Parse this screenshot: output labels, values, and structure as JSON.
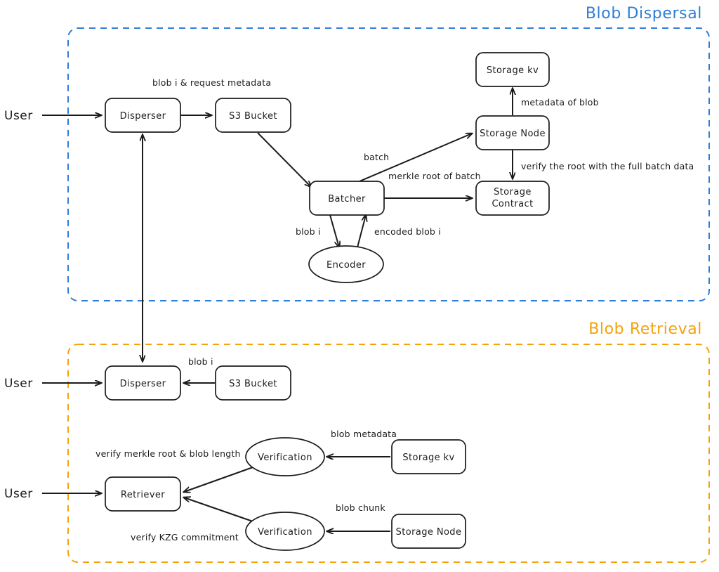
{
  "diagram": {
    "title_hidden": "",
    "colors": {
      "dispersal_accent": "#2f7ed8",
      "retrieval_accent": "#f5a30a",
      "stroke": "#1b1b1b",
      "background": "#ffffff"
    }
  },
  "groups": [
    {
      "id": "dispersal",
      "label": "Blob Dispersal",
      "color": "#2f7ed8"
    },
    {
      "id": "retrieval",
      "label": "Blob Retrieval",
      "color": "#f5a30a"
    }
  ],
  "dispersal": {
    "actors": [
      {
        "id": "user_top",
        "label": "User"
      }
    ],
    "nodes": [
      {
        "id": "disperser_top",
        "label": "Disperser",
        "shape": "box"
      },
      {
        "id": "s3_top",
        "label": "S3 Bucket",
        "shape": "box"
      },
      {
        "id": "batcher",
        "label": "Batcher",
        "shape": "box"
      },
      {
        "id": "encoder",
        "label": "Encoder",
        "shape": "ellipse"
      },
      {
        "id": "storage_kv_top",
        "label": "Storage kv",
        "shape": "box"
      },
      {
        "id": "storage_node_top",
        "label": "Storage Node",
        "shape": "box"
      },
      {
        "id": "storage_contract",
        "label_line1": "Storage",
        "label_line2": "Contract",
        "shape": "box"
      }
    ],
    "edges": [
      {
        "id": "e_user_disperser",
        "from": "user_top",
        "to": "disperser_top",
        "label": ""
      },
      {
        "id": "e_disperser_s3",
        "from": "disperser_top",
        "to": "s3_top",
        "label": "blob i & request metadata"
      },
      {
        "id": "e_s3_batcher",
        "from": "s3_top",
        "to": "batcher",
        "label": ""
      },
      {
        "id": "e_batcher_node",
        "from": "batcher",
        "to": "storage_node_top",
        "label": "batch"
      },
      {
        "id": "e_batcher_contract",
        "from": "batcher",
        "to": "storage_contract",
        "label": "merkle root of batch"
      },
      {
        "id": "e_batcher_encoder",
        "from": "batcher",
        "to": "encoder",
        "label": "blob i"
      },
      {
        "id": "e_encoder_batcher",
        "from": "encoder",
        "to": "batcher",
        "label": "encoded blob i"
      },
      {
        "id": "e_node_kv",
        "from": "storage_node_top",
        "to": "storage_kv_top",
        "label": "metadata of blob"
      },
      {
        "id": "e_node_contract",
        "from": "storage_node_top",
        "to": "storage_contract",
        "label": "verify the root with the full batch data"
      }
    ]
  },
  "retrieval": {
    "actors": [
      {
        "id": "user_mid",
        "label": "User"
      },
      {
        "id": "user_bottom",
        "label": "User"
      }
    ],
    "nodes": [
      {
        "id": "disperser_bottom",
        "label": "Disperser",
        "shape": "box"
      },
      {
        "id": "s3_bottom",
        "label": "S3 Bucket",
        "shape": "box"
      },
      {
        "id": "retriever",
        "label": "Retriever",
        "shape": "box"
      },
      {
        "id": "verification_top",
        "label": "Verification",
        "shape": "ellipse"
      },
      {
        "id": "verification_bottom",
        "label": "Verification",
        "shape": "ellipse"
      },
      {
        "id": "storage_kv_bottom",
        "label": "Storage kv",
        "shape": "box"
      },
      {
        "id": "storage_node_bottom",
        "label": "Storage Node",
        "shape": "box"
      }
    ],
    "edges": [
      {
        "id": "e_user_disperser_b",
        "from": "user_mid",
        "to": "disperser_bottom",
        "label": ""
      },
      {
        "id": "e_s3_disperser_b",
        "from": "s3_bottom",
        "to": "disperser_bottom",
        "label": "blob i"
      },
      {
        "id": "e_user_retriever",
        "from": "user_bottom",
        "to": "retriever",
        "label": ""
      },
      {
        "id": "e_verif_top_retriever",
        "from": "verification_top",
        "to": "retriever",
        "label": "verify merkle root & blob length"
      },
      {
        "id": "e_verif_bottom_retriever",
        "from": "verification_bottom",
        "to": "retriever",
        "label": "verify KZG commitment"
      },
      {
        "id": "e_kv_verif",
        "from": "storage_kv_bottom",
        "to": "verification_top",
        "label": "blob metadata"
      },
      {
        "id": "e_node_verif",
        "from": "storage_node_bottom",
        "to": "verification_bottom",
        "label": "blob chunk"
      }
    ]
  },
  "cross_edges": [
    {
      "id": "e_dispersers_link",
      "from": "disperser_bottom",
      "to": "disperser_top",
      "label": ""
    }
  ]
}
